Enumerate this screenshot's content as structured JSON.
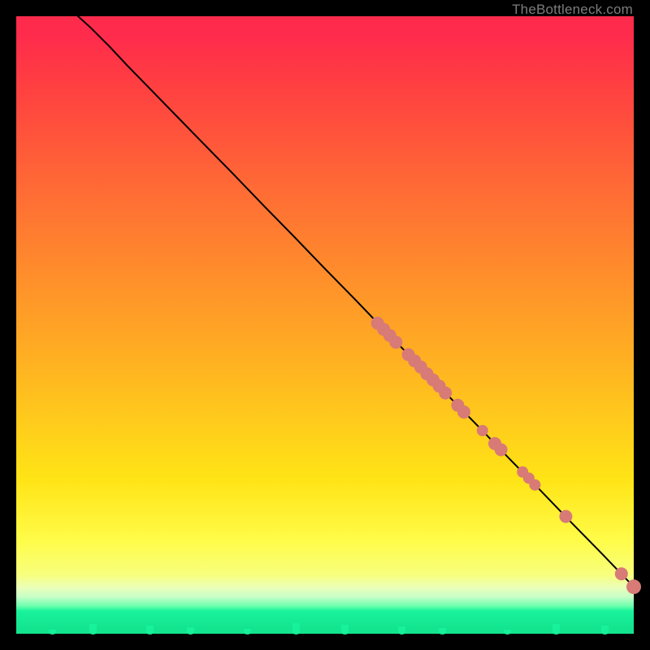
{
  "attribution": "TheBottleneck.com",
  "colors": {
    "curve_stroke": "#000000",
    "dot_fill": "#d87a76",
    "gradient_top": "#ff2b4c",
    "gradient_bottom": "#13e58f",
    "background": "#000000"
  },
  "chart_data": {
    "type": "line",
    "title": "",
    "xlabel": "",
    "ylabel": "",
    "xlim": [
      0,
      100
    ],
    "ylim": [
      0,
      100
    ],
    "grid": false,
    "legend": false,
    "curve": {
      "x": [
        10,
        12,
        15,
        18,
        22,
        26,
        30,
        35,
        40,
        45,
        50,
        55,
        60,
        65,
        70,
        75,
        80,
        85,
        90,
        95,
        100
      ],
      "y": [
        100,
        98.2,
        95.2,
        92,
        87.9,
        83.8,
        79.7,
        74.6,
        69.4,
        64.3,
        59.1,
        54,
        48.8,
        43.7,
        38.5,
        33.4,
        28.2,
        23.1,
        17.9,
        12.8,
        7.6
      ]
    },
    "series": [
      {
        "name": "highlighted-points",
        "type": "scatter",
        "x": [
          58.5,
          59.5,
          60.5,
          61.5,
          63.5,
          64.5,
          65.5,
          66.5,
          67.5,
          68.5,
          69.5,
          71.5,
          72.5,
          75.5,
          77.5,
          78.5,
          82.0,
          83.0,
          84.0,
          89.0,
          98.0,
          100.0
        ],
        "y": [
          50.3,
          49.3,
          48.3,
          47.2,
          45.2,
          44.2,
          43.2,
          42.1,
          41.1,
          40.1,
          39.0,
          37.0,
          35.9,
          32.9,
          30.8,
          29.8,
          26.2,
          25.2,
          24.1,
          19.0,
          9.7,
          7.6
        ],
        "size": [
          8,
          8,
          8,
          8,
          8,
          8,
          8,
          8,
          8,
          8,
          8,
          8,
          8,
          7,
          8,
          8,
          7,
          7,
          7,
          8,
          8,
          9
        ]
      }
    ]
  }
}
